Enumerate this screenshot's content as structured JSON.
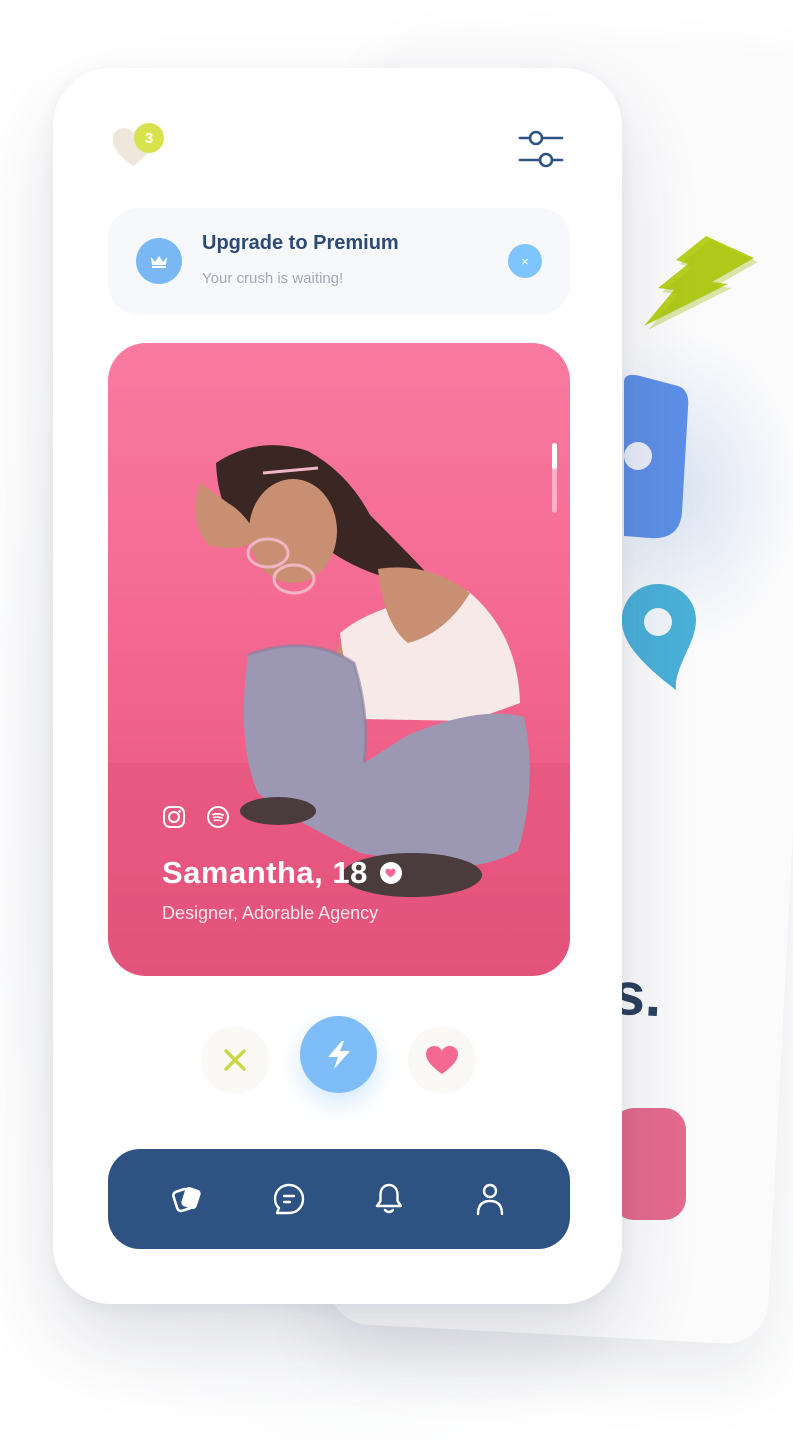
{
  "colors": {
    "accent_blue": "#7ebdf8",
    "navy": "#2e5282",
    "pink": "#f46991",
    "lime": "#d7e24c"
  },
  "header": {
    "matches_count": "3",
    "matches_icon": "heart-icon",
    "filter_icon": "sliders-icon"
  },
  "premium": {
    "icon": "crown-icon",
    "title": "Upgrade to Premium",
    "subtitle": "Your crush is waiting!",
    "close_label": "×"
  },
  "profile": {
    "name": "Samantha, 18",
    "job": "Designer, Adorable Agency",
    "verified_icon": "verified-heart-icon",
    "socials": [
      "instagram-icon",
      "spotify-icon"
    ]
  },
  "actions": {
    "reject_icon": "close-x-icon",
    "boost_icon": "bolt-icon",
    "like_icon": "heart-icon"
  },
  "nav": {
    "items": [
      "cards-icon",
      "chat-icon",
      "bell-icon",
      "user-icon"
    ]
  }
}
